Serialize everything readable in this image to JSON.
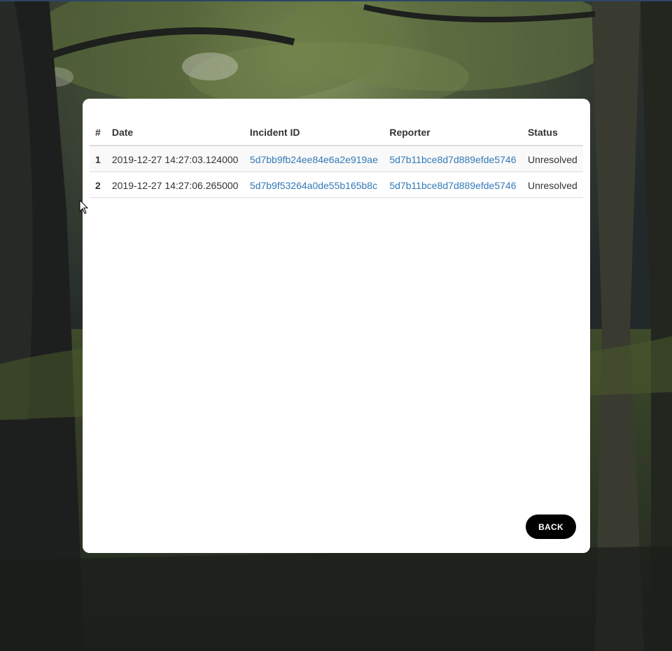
{
  "table": {
    "headers": [
      "#",
      "Date",
      "Incident ID",
      "Reporter",
      "Status"
    ],
    "rows": [
      {
        "num": "1",
        "date": "2019-12-27 14:27:03.124000",
        "incident_id": "5d7bb9fb24ee84e6a2e919ae",
        "reporter": "5d7b11bce8d7d889efde5746",
        "status": "Unresolved"
      },
      {
        "num": "2",
        "date": "2019-12-27 14:27:06.265000",
        "incident_id": "5d7b9f53264a0de55b165b8c",
        "reporter": "5d7b11bce8d7d889efde5746",
        "status": "Unresolved"
      }
    ]
  },
  "actions": {
    "back_label": "BACK"
  },
  "colors": {
    "link": "#337ab7",
    "button_bg": "#000000",
    "card_bg": "#ffffff"
  }
}
